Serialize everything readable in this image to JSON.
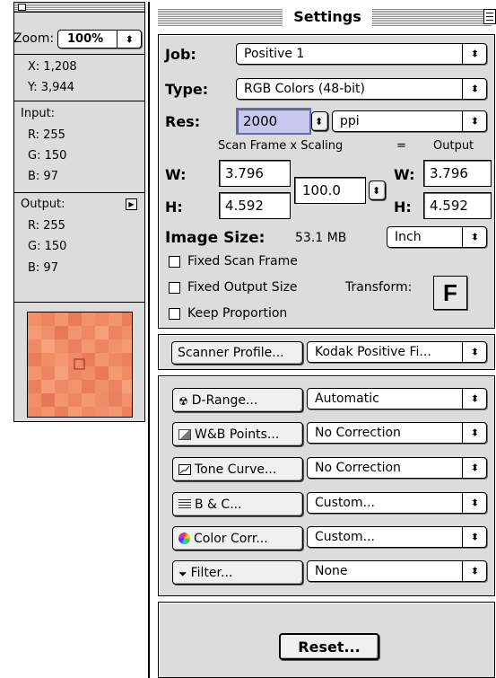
{
  "info_panel": {
    "zoom_label": "Zoom:",
    "zoom_value": "100%",
    "x": "X: 1,208",
    "y": "Y: 3,944",
    "input_label": "Input:",
    "input_r": "R: 255",
    "input_g": "G: 150",
    "input_b": "B: 97",
    "output_label": "Output:",
    "output_r": "R: 255",
    "output_g": "G: 150",
    "output_b": "B: 97"
  },
  "settings": {
    "title": "Settings",
    "job_label": "Job:",
    "job_value": "Positive 1",
    "type_label": "Type:",
    "type_value": "RGB Colors (48-bit)",
    "res_label": "Res:",
    "res_value": "2000",
    "res_unit": "ppi",
    "scan_frame_header": "Scan Frame x Scaling",
    "equals": "=",
    "output_header": "Output",
    "w_label": "W:",
    "h_label": "H:",
    "scan_w": "3.796",
    "scan_h": "4.592",
    "scaling": "100.0",
    "out_w_label": "W:",
    "out_h_label": "H:",
    "out_w": "3.796",
    "out_h": "4.592",
    "image_size_label": "Image Size:",
    "image_size_value": "53.1 MB",
    "image_size_unit": "Inch",
    "fixed_scan_frame": "Fixed Scan Frame",
    "fixed_output_size": "Fixed Output Size",
    "transform_label": "Transform:",
    "transform_glyph": "F",
    "keep_proportion": "Keep Proportion",
    "scanner_profile_button": "Scanner Profile...",
    "scanner_profile_value": "Kodak Positive Fi...",
    "drange_button": "D-Range...",
    "drange_value": "Automatic",
    "wb_button": "W&B Points...",
    "wb_value": "No Correction",
    "tone_button": "Tone Curve...",
    "tone_value": "No Correction",
    "bc_button": "B & C...",
    "bc_value": "Custom...",
    "colorcorr_button": "Color Corr...",
    "colorcorr_value": "Custom...",
    "filter_button": "Filter...",
    "filter_value": "None",
    "reset_button": "Reset..."
  },
  "colors": {
    "panel_bg": "#dcdcdc",
    "res_highlight": "#c7c7f0",
    "swatch_base": "#ee8a63"
  }
}
